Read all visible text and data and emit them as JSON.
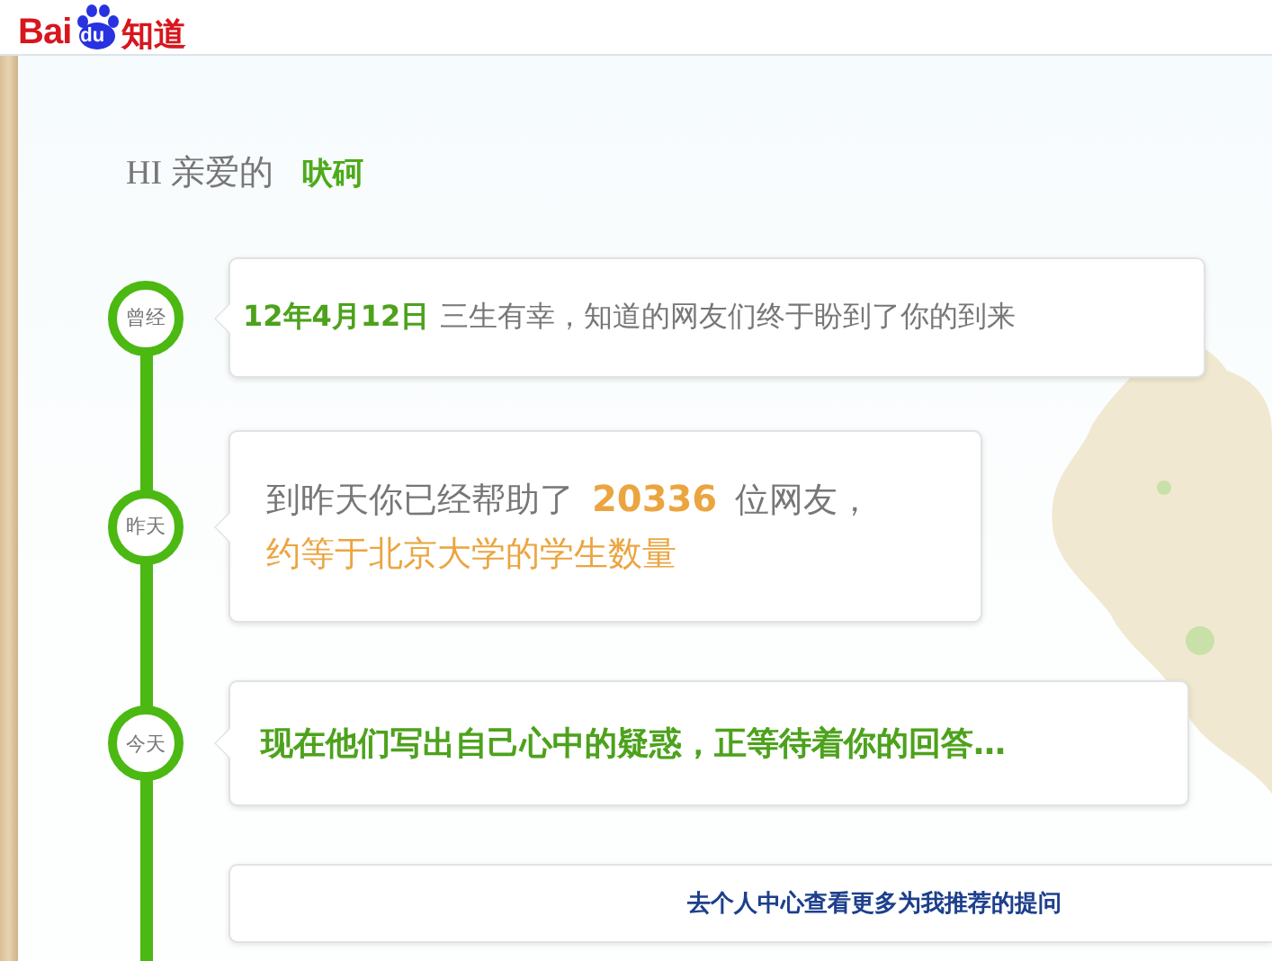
{
  "header": {
    "logo": {
      "left": "Bai",
      "paw": "du",
      "right": "知道"
    }
  },
  "greeting": {
    "prefix": "HI 亲爱的",
    "name": "吠砢"
  },
  "timeline": [
    {
      "kind": "intro",
      "marker": "曾经",
      "date": "12年4月12日",
      "text": "三生有幸，知道的网友们终于盼到了你的到来"
    },
    {
      "kind": "stat",
      "marker": "昨天",
      "before": "到昨天你已经帮助了",
      "number": "20336",
      "after": "位网友，",
      "note": "约等于北京大学的学生数量"
    },
    {
      "kind": "prompt",
      "marker": "今天",
      "text": "现在他们写出自己心中的疑惑，正等待着你的回答…"
    }
  ],
  "link": {
    "label": "去个人中心查看更多为我推荐的提问"
  }
}
